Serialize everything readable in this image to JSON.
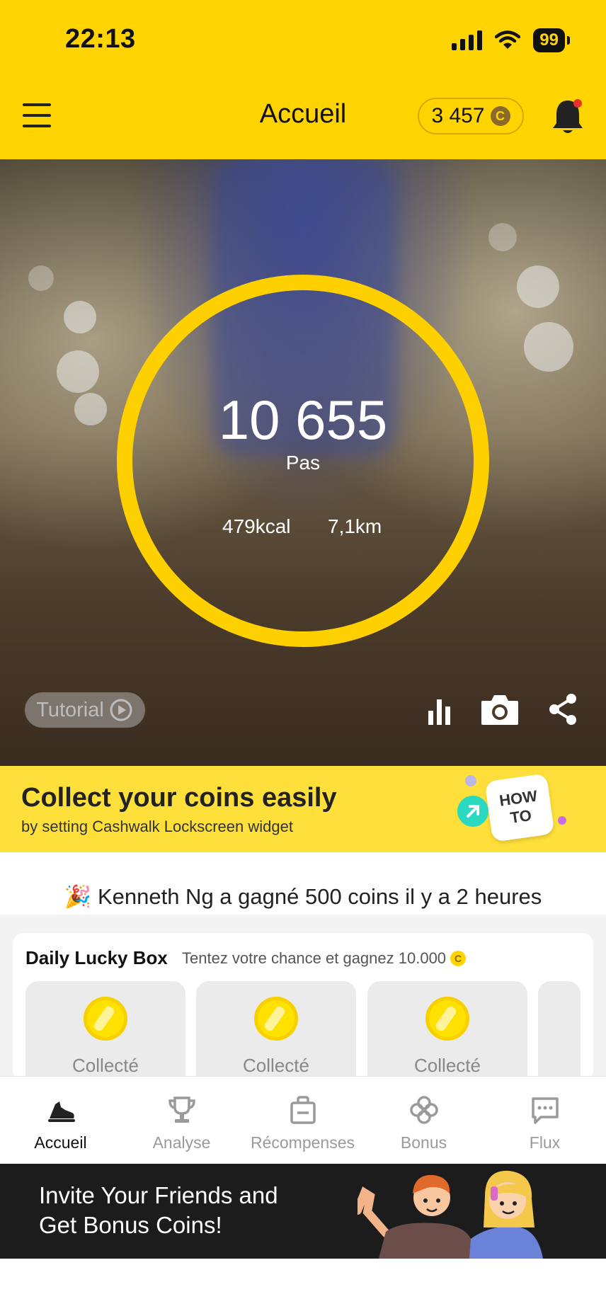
{
  "status_bar": {
    "time": "22:13",
    "battery": "99"
  },
  "header": {
    "title": "Accueil",
    "coins": "3 457",
    "coin_symbol": "C"
  },
  "hero": {
    "steps": "10 655",
    "steps_label": "Pas",
    "kcal": "479kcal",
    "distance": "7,1km",
    "tutorial_label": "Tutorial",
    "ring_color": "#FFD000"
  },
  "banner": {
    "title": "Collect your coins easily",
    "subtitle": "by setting Cashwalk Lockscreen widget",
    "howto": "HOW\nTO"
  },
  "notice": {
    "emoji": "🎉",
    "text": "Kenneth Ng a gagné 500 coins il y a 2 heures"
  },
  "lucky_box": {
    "title": "Daily Lucky Box",
    "subtitle": "Tentez votre chance et gagnez 10.000",
    "coin_symbol": "C",
    "boxes": [
      {
        "label": "Collecté"
      },
      {
        "label": "Collecté"
      },
      {
        "label": "Collecté"
      }
    ]
  },
  "tabs": [
    {
      "label": "Accueil",
      "icon": "sneaker-icon",
      "active": true
    },
    {
      "label": "Analyse",
      "icon": "trophy-icon",
      "active": false
    },
    {
      "label": "Récompenses",
      "icon": "shopping-bag-icon",
      "active": false
    },
    {
      "label": "Bonus",
      "icon": "clover-icon",
      "active": false
    },
    {
      "label": "Flux",
      "icon": "chat-bubble-icon",
      "active": false
    }
  ],
  "invite": {
    "text": "Invite Your Friends and\nGet Bonus Coins!"
  },
  "colors": {
    "brand_yellow": "#FFD400",
    "banner_yellow": "#FFE03A",
    "dark": "#1c1c1c"
  }
}
